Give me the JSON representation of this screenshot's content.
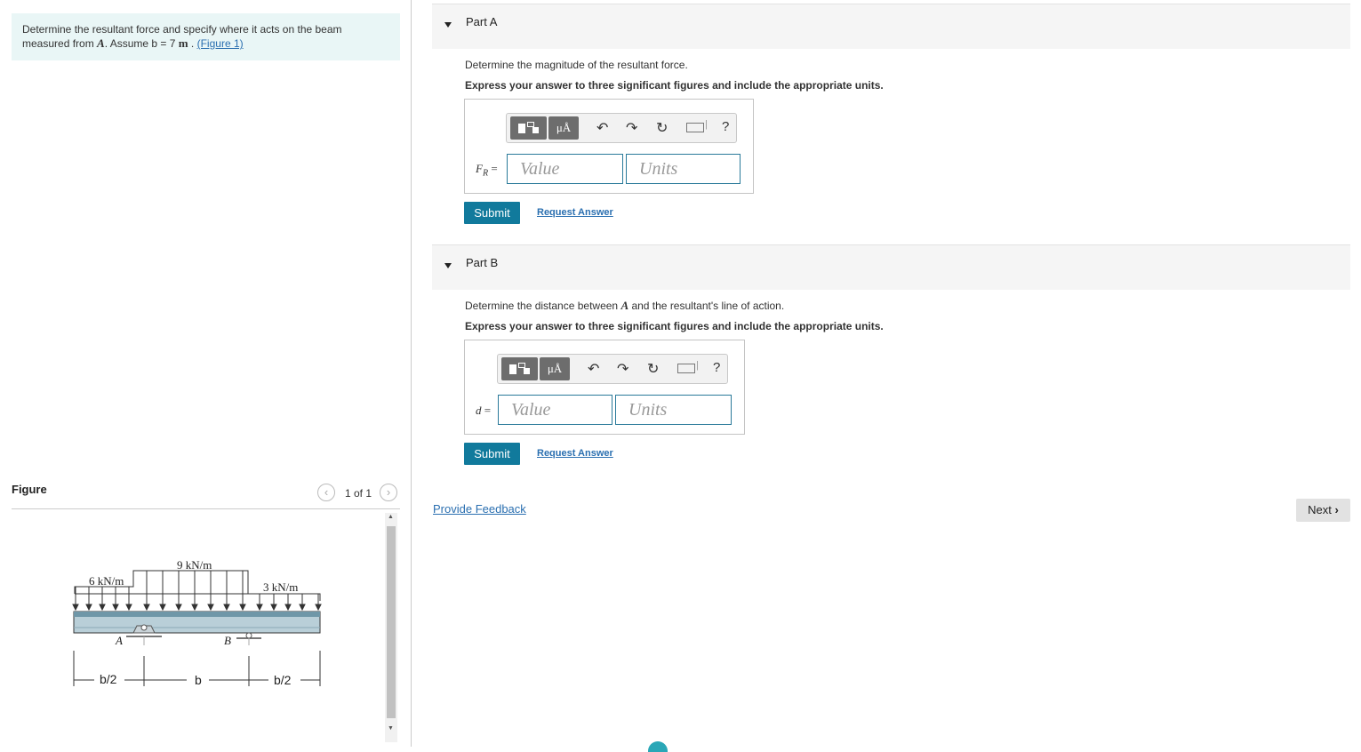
{
  "problem": {
    "text_before": "Determine the resultant force and specify where it acts on the beam measured from ",
    "point": "A",
    "text_after": ". Assume b = 7 ",
    "unit": "m",
    "sep": " . ",
    "figure_link": "(Figure 1)"
  },
  "figure": {
    "title": "Figure",
    "pager": "1 of 1",
    "prev_icon": "chevron-left-icon",
    "next_icon": "chevron-right-icon",
    "labels": {
      "load_left": "6 kN/m",
      "load_mid": "9 kN/m",
      "load_right": "3 kN/m",
      "point_a": "A",
      "point_b": "B",
      "dim_1": "b/2",
      "dim_2": "b",
      "dim_3": "b/2"
    }
  },
  "parts": [
    {
      "label": "Part A",
      "question": "Determine the magnitude of the resultant force.",
      "instruction": "Express your answer to three significant figures and include the appropriate units.",
      "var_main": "F",
      "var_sub": "R",
      "eq": " =",
      "value_placeholder": "Value",
      "units_placeholder": "Units",
      "submit": "Submit",
      "request": "Request Answer"
    },
    {
      "label": "Part B",
      "question_before": "Determine the distance between ",
      "question_point": "A",
      "question_after": " and the resultant's line of action.",
      "instruction": "Express your answer to three significant figures and include the appropriate units.",
      "var_main": "d",
      "eq": " =",
      "value_placeholder": "Value",
      "units_placeholder": "Units",
      "submit": "Submit",
      "request": "Request Answer"
    }
  ],
  "toolbar": {
    "mu_label": "μÅ",
    "help": "?",
    "icons": [
      "templates-icon",
      "units-icon",
      "undo-icon",
      "redo-icon",
      "reset-icon",
      "keyboard-icon",
      "help-icon"
    ]
  },
  "footer": {
    "feedback": "Provide Feedback",
    "next": "Next",
    "next_icon": "chevron-right-icon"
  },
  "colors": {
    "accent": "#117a9c",
    "link": "#2a6fb0",
    "problem_bg": "#e9f6f6",
    "beam": "#b9cfd8"
  }
}
